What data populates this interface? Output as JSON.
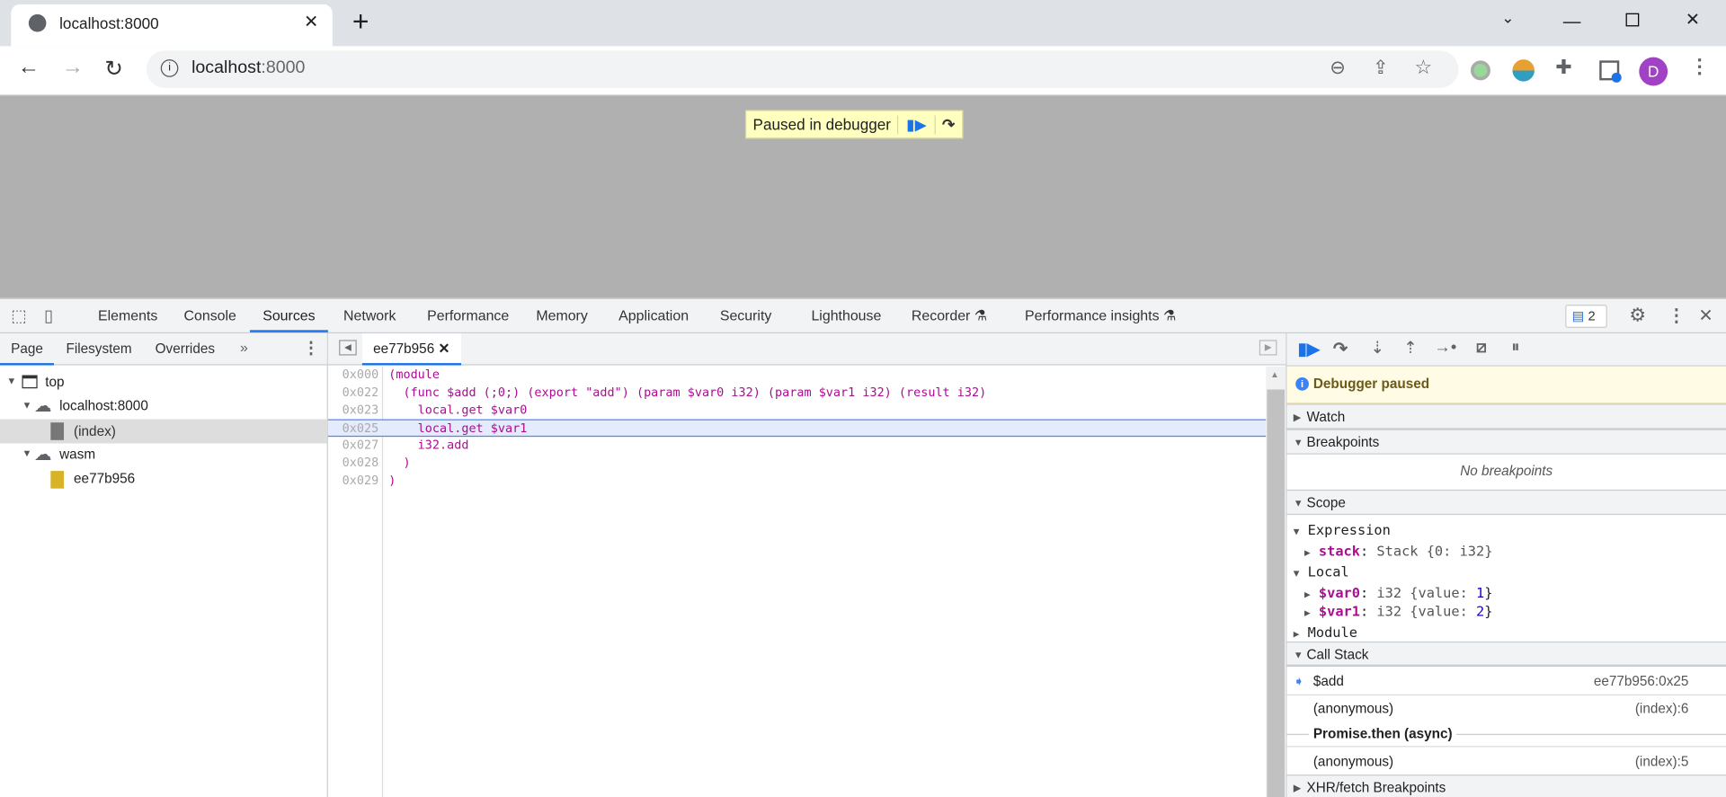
{
  "browser": {
    "tab_title": "localhost:8000",
    "url_host": "localhost",
    "url_port": ":8000",
    "profile_initial": "D"
  },
  "page": {
    "paused_text": "Paused in debugger"
  },
  "devtools": {
    "tabs": [
      "Elements",
      "Console",
      "Sources",
      "Network",
      "Performance",
      "Memory",
      "Application",
      "Security",
      "Lighthouse",
      "Recorder",
      "Performance insights"
    ],
    "active_tab": "Sources",
    "issues_count": "2",
    "navigator": {
      "tabs": [
        "Page",
        "Filesystem",
        "Overrides"
      ],
      "tree": [
        "top",
        "localhost:8000",
        "(index)",
        "wasm",
        "ee77b956"
      ]
    },
    "editor": {
      "file_tab": "ee77b956",
      "lines": [
        {
          "addr": "0x000",
          "text": "(module"
        },
        {
          "addr": "0x022",
          "text": "  (func $add (;0;) (export \"add\") (param $var0 i32) (param $var1 i32) (result i32)"
        },
        {
          "addr": "0x023",
          "text": "    local.get $var0"
        },
        {
          "addr": "0x025",
          "text": "    local.get $var1"
        },
        {
          "addr": "0x027",
          "text": "    i32.add"
        },
        {
          "addr": "0x028",
          "text": "  )"
        },
        {
          "addr": "0x029",
          "text": ")"
        }
      ],
      "current_line": "0x025"
    },
    "sidebar": {
      "paused_label": "Debugger paused",
      "watch": "Watch",
      "breakpoints": "Breakpoints",
      "no_breakpoints": "No breakpoints",
      "scope": "Scope",
      "expression": "Expression",
      "stack_name": "stack",
      "stack_val": "Stack {0: i32}",
      "local": "Local",
      "vars": [
        {
          "name": "$var0",
          "type": "i32 {value: ",
          "value": "1"
        },
        {
          "name": "$var1",
          "type": "i32 {value: ",
          "value": "2"
        }
      ],
      "module": "Module",
      "call_stack": "Call Stack",
      "frames": [
        {
          "name": "$add",
          "loc": "ee77b956:0x25"
        },
        {
          "name": "(anonymous)",
          "loc": "(index):6"
        },
        {
          "name": "(anonymous)",
          "loc": "(index):5"
        }
      ],
      "async_label": "Promise.then (async)",
      "xhr": "XHR/fetch Breakpoints"
    }
  },
  "colors": {
    "accent": "#1a73e8",
    "paused_bg": "#ffffc0",
    "current_line": "#e3ebfc"
  }
}
